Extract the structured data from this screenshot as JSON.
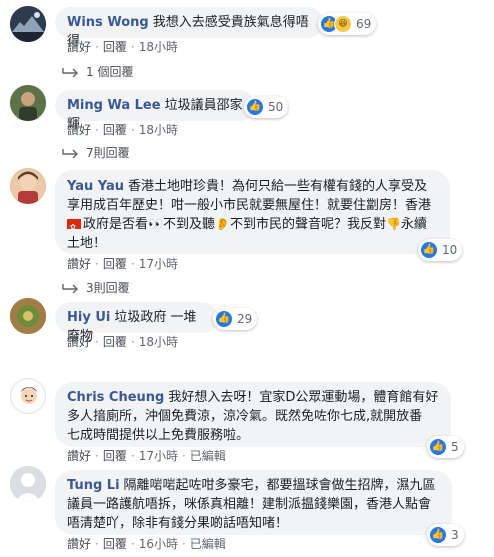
{
  "comments": [
    {
      "name": "Wins Wong",
      "text": "我想入去感受貴族氣息得唔得",
      "reactions": [
        "like",
        "haha"
      ],
      "reaction_count": "69",
      "actions": {
        "like": "讚好",
        "reply": "回覆",
        "time": "18小時"
      },
      "replies_label": "1 個回覆"
    },
    {
      "name": "Ming Wa Lee",
      "text": "垃圾議員邵家輝",
      "reactions": [
        "like"
      ],
      "reaction_count": "50",
      "actions": {
        "like": "讚好",
        "reply": "回覆",
        "time": "18小時"
      },
      "replies_label": "7則回覆"
    },
    {
      "name": "Yau Yau",
      "text_line1": "香港土地咁珍貴！為何只給一些有權有錢的人享受及",
      "text_line2": "享用成百年歷史！咁一般小市民就要無屋住！就要住劏房！香港",
      "text_line3a": "政府是否看",
      "text_line3b": "不到及聽",
      "text_line3c": "不到市民的聲音呢？我反對",
      "text_line3d": "永續",
      "text_line4": "土地！",
      "emoji_eyes": "👀",
      "emoji_ear": "👂",
      "emoji_point": "👎",
      "reactions": [
        "like"
      ],
      "reaction_count": "10",
      "actions": {
        "like": "讚好",
        "reply": "回覆",
        "time": "17小時"
      },
      "replies_label": "3則回覆"
    },
    {
      "name": "Hiy Ui",
      "text": "垃圾政府 一堆廢物",
      "reactions": [
        "like"
      ],
      "reaction_count": "29",
      "actions": {
        "like": "讚好",
        "reply": "回覆",
        "time": "18小時"
      }
    },
    {
      "name": "Chris Cheung",
      "text_line1": "我好想入去呀！宜家D公眾運動場，體育館有好",
      "text_line2": "多人揞廁所，沖個免費涼，涼冷氣。既然免咗你七成,就開放番",
      "text_line3": "七成時間提供以上免費服務啦。",
      "reactions": [
        "like"
      ],
      "reaction_count": "5",
      "actions": {
        "like": "讚好",
        "reply": "回覆",
        "time": "17小時",
        "edited": "已編輯"
      }
    },
    {
      "name": "Tung Li",
      "text_line1": "隔離啱啱起咗咁多豪宅，都要搵球會做生招牌，濕九區",
      "text_line2": "議員一路護航唔拆，咪係真相離！建制派揾錢樂園，香港人點會",
      "text_line3": "唔清楚吖，除非有錢分果啲話唔知啫！",
      "reactions": [
        "like"
      ],
      "reaction_count": "3",
      "actions": {
        "like": "讚好",
        "reply": "回覆",
        "time": "16小時",
        "edited": "已編輯"
      }
    }
  ],
  "colors": {
    "name": "#385898",
    "bubble": "#f2f3f5",
    "like": "#2078f4",
    "meta": "#606770"
  }
}
